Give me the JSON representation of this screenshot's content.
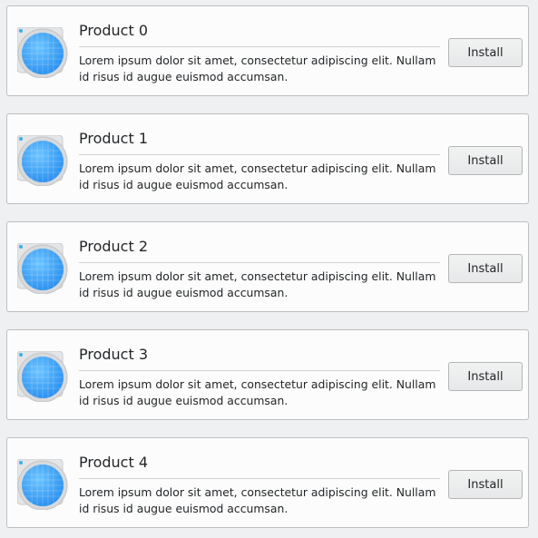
{
  "products": [
    {
      "title": "Product 0",
      "description": "Lorem ipsum dolor sit amet, consectetur adipiscing elit. Nullam id risus id augue euismod accumsan.",
      "button_label": "Install",
      "icon": "globe-icon"
    },
    {
      "title": "Product 1",
      "description": "Lorem ipsum dolor sit amet, consectetur adipiscing elit. Nullam id risus id augue euismod accumsan.",
      "button_label": "Install",
      "icon": "globe-icon"
    },
    {
      "title": "Product 2",
      "description": "Lorem ipsum dolor sit amet, consectetur adipiscing elit. Nullam id risus id augue euismod accumsan.",
      "button_label": "Install",
      "icon": "globe-icon"
    },
    {
      "title": "Product 3",
      "description": "Lorem ipsum dolor sit amet, consectetur adipiscing elit. Nullam id risus id augue euismod accumsan.",
      "button_label": "Install",
      "icon": "globe-icon"
    },
    {
      "title": "Product 4",
      "description": "Lorem ipsum dolor sit amet, consectetur adipiscing elit. Nullam id risus id augue euismod accumsan.",
      "button_label": "Install",
      "icon": "globe-icon"
    }
  ],
  "colors": {
    "accent": "#3daee9",
    "icon_blue": "#2a8ff0",
    "card_background": "#fcfcfc",
    "window_background": "#eff0f1"
  }
}
